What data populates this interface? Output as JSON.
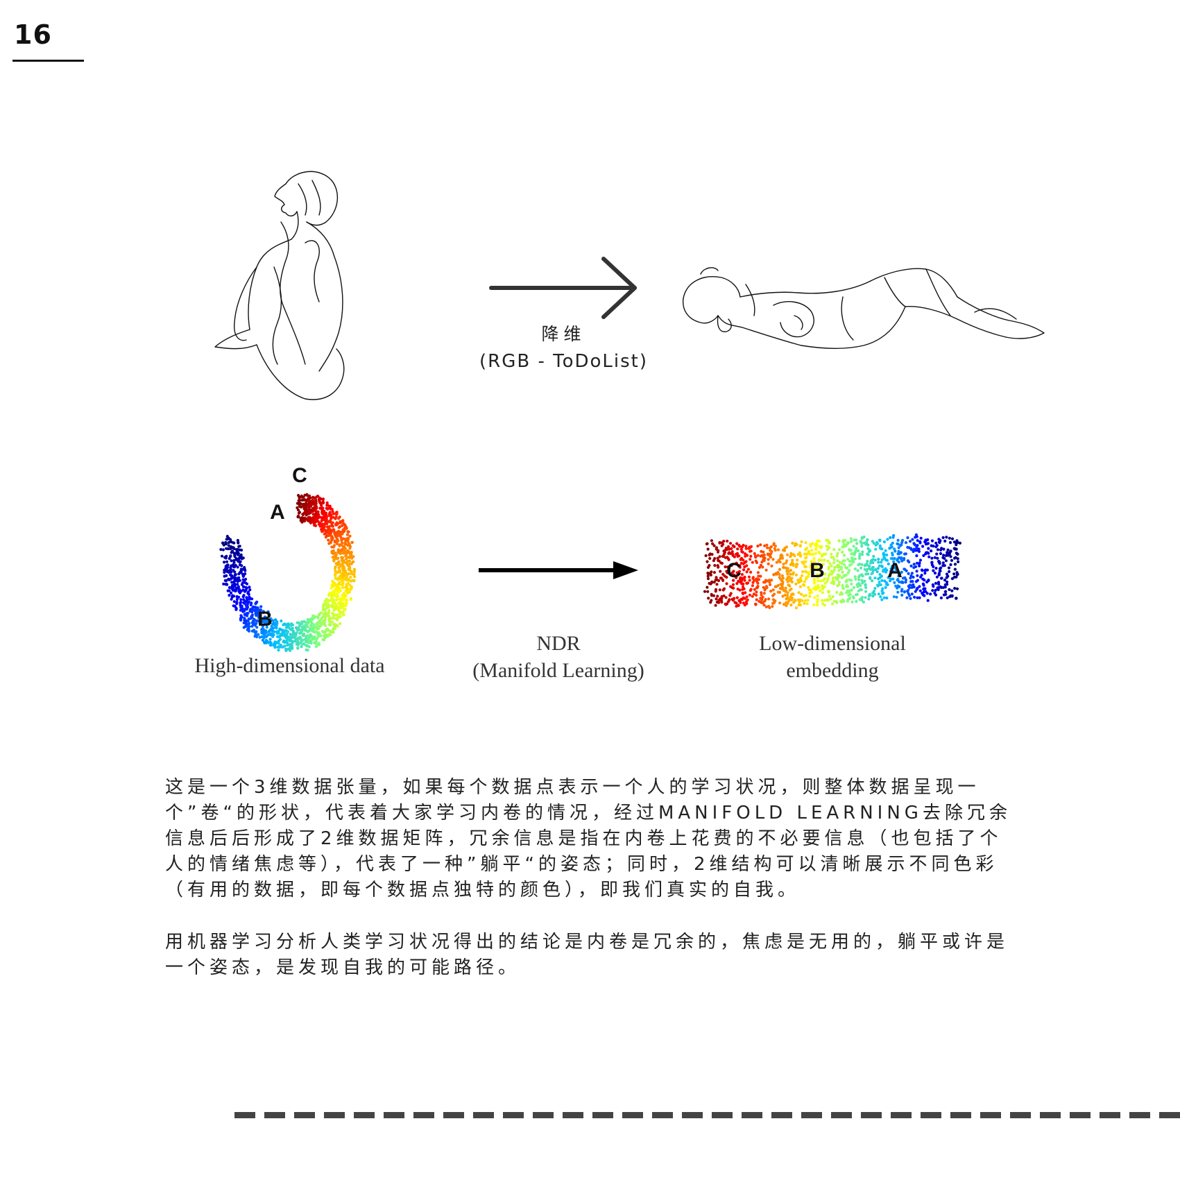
{
  "page_number": "16",
  "top_diagram": {
    "caption_cn": "降维",
    "caption_rgb": "(RGB - ToDoList)",
    "left_icon": "sitting-figure-line-drawing",
    "right_icon": "lying-figure-line-drawing",
    "arrow_icon": "right-arrow-icon"
  },
  "manifold_figure": {
    "left_label": "High-dimensional data",
    "middle_label_line1": "NDR",
    "middle_label_line2": "(Manifold Learning)",
    "right_label_line1": "Low-dimensional",
    "right_label_line2": "embedding",
    "point_labels": {
      "a": "A",
      "b": "B",
      "c": "C"
    },
    "colormap": [
      "#00007f",
      "#0000ff",
      "#00bfff",
      "#7fff7f",
      "#ffff00",
      "#ff7f00",
      "#ff0000",
      "#7f0000"
    ]
  },
  "body": {
    "paragraph_1": "这是一个3维数据张量，如果每个数据点表示一个人的学习状况，则整体数据呈现一个”卷“的形状，代表着大家学习内卷的情况，经过MANIFOLD LEARNING去除冗余信息后后形成了2维数据矩阵，冗余信息是指在内卷上花费的不必要信息（也包括了个人的情绪焦虑等），代表了一种”躺平“的姿态；同时，2维结构可以清晰展示不同色彩（有用的数据，即每个数据点独特的颜色），即我们真实的自我。",
    "paragraph_2": "用机器学习分析人类学习状况得出的结论是内卷是冗余的，焦虑是无用的，躺平或许是一个姿态，是发现自我的可能路径。"
  }
}
